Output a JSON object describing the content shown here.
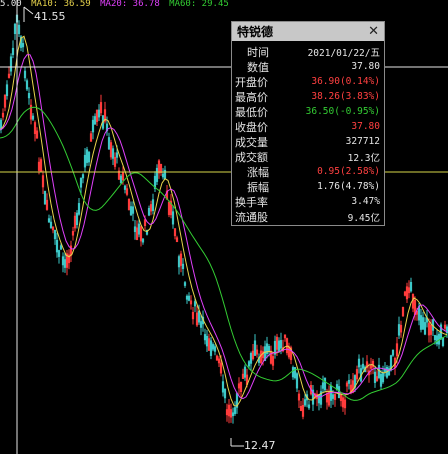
{
  "colors": {
    "background": "#000000",
    "up": "#ff3b3b",
    "down": "#3cc8c8",
    "ma_yellow": "#e8d44c",
    "ma_magenta": "#e040fb",
    "ma_green": "#33cc33",
    "crosshair": "#e6e6e6",
    "horizontal_line": "#d8d84a",
    "text_white": "#e6e6e6",
    "text_red": "#ff4040",
    "text_green": "#33cc33"
  },
  "ma_labels": [
    "5.00",
    "MA10: 36.59",
    "MA20: 36.78",
    "MA60: 29.45"
  ],
  "price_range": {
    "max": 41.55,
    "min": 12.47
  },
  "high_label": "41.55",
  "low_label": "12.47",
  "panel": {
    "title": "特锐德",
    "close_icon": "close-icon",
    "rows": [
      {
        "label": "时间",
        "value": "2021/01/22/五",
        "color": "white",
        "indent": true
      },
      {
        "label": "数值",
        "value": "37.80",
        "color": "white",
        "indent": true
      },
      {
        "label": "开盘价",
        "value": "36.90(0.14%)",
        "color": "red",
        "indent": false
      },
      {
        "label": "最高价",
        "value": "38.26(3.83%)",
        "color": "red",
        "indent": false
      },
      {
        "label": "最低价",
        "value": "36.50(-0.95%)",
        "color": "green",
        "indent": false
      },
      {
        "label": "收盘价",
        "value": "37.80",
        "color": "red",
        "indent": false
      },
      {
        "label": "成交量",
        "value": "327712",
        "color": "white",
        "indent": false
      },
      {
        "label": "成交额",
        "value": "12.3亿",
        "color": "white",
        "indent": false
      },
      {
        "label": "涨幅",
        "value": "0.95(2.58%)",
        "color": "red",
        "indent": true
      },
      {
        "label": "振幅",
        "value": "1.76(4.78%)",
        "color": "white",
        "indent": true
      },
      {
        "label": "换手率",
        "value": "3.47%",
        "color": "white",
        "indent": false
      },
      {
        "label": "流通股",
        "value": "9.45亿",
        "color": "white",
        "indent": false
      }
    ]
  }
}
